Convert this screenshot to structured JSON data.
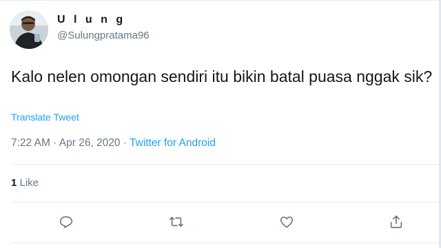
{
  "user": {
    "name": "U l u n g",
    "handle": "@Sulungpratama96"
  },
  "tweet": {
    "text": "Kalo nelen omongan sendiri itu bikin batal puasa nggak sik?",
    "translate_label": "Translate Tweet",
    "time": "7:22 AM · Apr 26, 2020 · ",
    "source": "Twitter for Android"
  },
  "stats": {
    "likes_count": "1",
    "likes_label": " Like"
  },
  "actions": {
    "icons": [
      "reply-icon",
      "retweet-icon",
      "like-icon",
      "share-icon"
    ]
  },
  "colors": {
    "link": "#1da1f2",
    "secondary_text": "#657786",
    "primary_text": "#14171a",
    "divider": "#e6ecf0"
  }
}
